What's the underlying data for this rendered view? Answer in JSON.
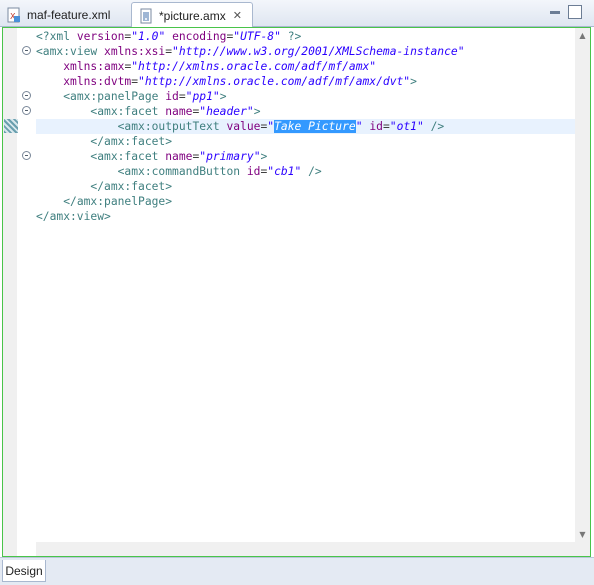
{
  "tabs": [
    {
      "label": "maf-feature.xml",
      "icon": "xml-file-icon"
    },
    {
      "label": "*picture.amx",
      "icon": "amx-file-icon",
      "close": "✕"
    }
  ],
  "window_buttons": {
    "minimize": "minimize-icon",
    "maximize": "maximize-icon"
  },
  "code": {
    "line1": {
      "open": "<?xml ",
      "a1": "version",
      "eq1": "=",
      "v1": "\"1.0\"",
      "sp": " ",
      "a2": "encoding",
      "eq2": "=",
      "v2": "\"UTF-8\"",
      "close": " ?>"
    },
    "line2": {
      "tag": "<amx:view ",
      "a1": "xmlns:xsi",
      "eq": "=",
      "v1": "\"http://www.w3.org/2001/XMLSchema-instance\""
    },
    "line3": {
      "indent": "    ",
      "a1": "xmlns:amx",
      "eq": "=",
      "v1": "\"http://xmlns.oracle.com/adf/mf/amx\""
    },
    "line4": {
      "indent": "    ",
      "a1": "xmlns:dvtm",
      "eq": "=",
      "v1": "\"http://xmlns.oracle.com/adf/mf/amx/dvt\"",
      "close": ">"
    },
    "line5": {
      "indent": "    ",
      "tag": "<amx:panelPage ",
      "a1": "id",
      "eq": "=",
      "v1": "\"pp1\"",
      "close": ">"
    },
    "line6": {
      "indent": "        ",
      "tag": "<amx:facet ",
      "a1": "name",
      "eq": "=",
      "v1": "\"header\"",
      "close": ">"
    },
    "line7": {
      "indent": "            ",
      "tag": "<amx:outputText ",
      "a1": "value",
      "eq": "=",
      "q1": "\"",
      "selected": "Take Picture",
      "q2": "\"",
      "sp": " ",
      "a2": "id",
      "eq2": "=",
      "v2": "\"ot1\"",
      "close": " />"
    },
    "line8": {
      "indent": "        ",
      "tag": "</amx:facet>"
    },
    "line9": {
      "indent": "        ",
      "tag": "<amx:facet ",
      "a1": "name",
      "eq": "=",
      "v1": "\"primary\"",
      "close": ">"
    },
    "line10": {
      "indent": "            ",
      "tag": "<amx:commandButton ",
      "a1": "id",
      "eq": "=",
      "v1": "\"cb1\"",
      "close": " />"
    },
    "line11": {
      "indent": "        ",
      "tag": "</amx:facet>"
    },
    "line12": {
      "indent": "    ",
      "tag": "</amx:panelPage>"
    },
    "line13": {
      "tag": "</amx:view>"
    }
  },
  "scroll_arrows": {
    "up": "▲",
    "down": "▼"
  },
  "bottom_tabs": [
    {
      "label": "Design"
    }
  ],
  "colors": {
    "editor_border": "#49c449",
    "selection": "#3399ff",
    "current_line": "#e8f2fe",
    "tag": "#3f7f7f",
    "attribute": "#7f007f",
    "value": "#2a00ff"
  }
}
